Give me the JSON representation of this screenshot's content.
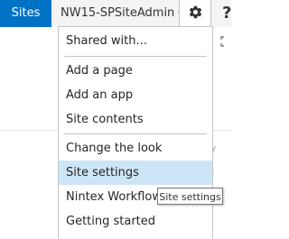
{
  "topbar": {
    "sites_label": "Sites",
    "user_name": "NW15-SPSiteAdmin",
    "accent_color": "#0072c6"
  },
  "menu": {
    "items": [
      {
        "label": "Shared with..."
      },
      {
        "label": "Add a page"
      },
      {
        "label": "Add an app"
      },
      {
        "label": "Site contents"
      },
      {
        "label": "Change the look"
      },
      {
        "label": "Site settings",
        "state": "hovered"
      },
      {
        "label": "Nintex Workflow"
      },
      {
        "label": "Getting started"
      }
    ],
    "highlight_color": "#cde6f7"
  },
  "tooltip": {
    "text": "Site settings"
  },
  "icons": {
    "settings": "gear-icon",
    "help": "help-icon",
    "focus": "focus-mode-icon"
  }
}
